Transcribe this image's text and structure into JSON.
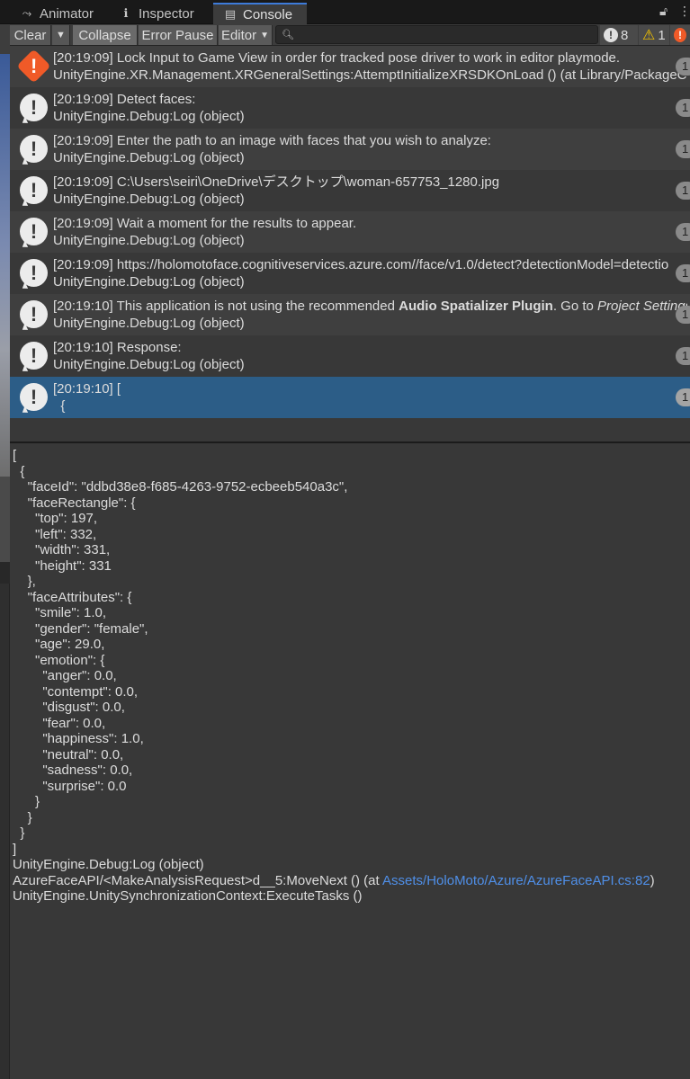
{
  "tabs": [
    {
      "label": "Animator",
      "icon": "animator-icon"
    },
    {
      "label": "Inspector",
      "icon": "info-icon"
    },
    {
      "label": "Console",
      "icon": "console-icon"
    }
  ],
  "toolbar": {
    "clear": "Clear",
    "collapse": "Collapse",
    "error_pause": "Error Pause",
    "editor": "Editor",
    "search_placeholder": "",
    "log_count": "8",
    "warn_count": "1",
    "error_count": ""
  },
  "rows": [
    {
      "type": "error",
      "line1": "[20:19:09] Lock Input to Game View in order for tracked pose driver to work in editor playmode.",
      "line2": "UnityEngine.XR.Management.XRGeneralSettings:AttemptInitializeXRSDKOnLoad () (at Library/PackageC",
      "count": "1"
    },
    {
      "type": "log",
      "line1": "[20:19:09] Detect faces:",
      "line2": "UnityEngine.Debug:Log (object)",
      "count": "1"
    },
    {
      "type": "log",
      "line1": "[20:19:09] Enter the path to an image with faces that you wish to analyze:",
      "line2": "UnityEngine.Debug:Log (object)",
      "count": "1"
    },
    {
      "type": "log",
      "line1": "[20:19:09] C:\\Users\\seiri\\OneDrive\\デスクトップ\\woman-657753_1280.jpg",
      "line2": "UnityEngine.Debug:Log (object)",
      "count": "1"
    },
    {
      "type": "log",
      "line1": "[20:19:09] Wait a moment for the results to appear.",
      "line2": "UnityEngine.Debug:Log (object)",
      "count": "1"
    },
    {
      "type": "log",
      "line1": "[20:19:09] https://holomotoface.cognitiveservices.azure.com//face/v1.0/detect?detectionModel=detectio",
      "line2": "UnityEngine.Debug:Log (object)",
      "count": "1"
    },
    {
      "type": "log",
      "line1_pre": "[20:19:10] This application is not using the recommended ",
      "line1_bold": "Audio Spatializer Plugin",
      "line1_mid": ". Go to ",
      "line1_italic": "Project Settings",
      "line2": "UnityEngine.Debug:Log (object)",
      "count": "1"
    },
    {
      "type": "log",
      "line1": "[20:19:10] Response:",
      "line2": "UnityEngine.Debug:Log (object)",
      "count": "1"
    },
    {
      "type": "log",
      "line1": "[20:19:10] [",
      "line2": "  {",
      "count": "1",
      "selected": true
    }
  ],
  "detail": {
    "lines": [
      "[",
      "  {",
      "    \"faceId\": \"ddbd38e8-f685-4263-9752-ecbeeb540a3c\",",
      "    \"faceRectangle\": {",
      "      \"top\": 197,",
      "      \"left\": 332,",
      "      \"width\": 331,",
      "      \"height\": 331",
      "    },",
      "    \"faceAttributes\": {",
      "      \"smile\": 1.0,",
      "      \"gender\": \"female\",",
      "      \"age\": 29.0,",
      "      \"emotion\": {",
      "        \"anger\": 0.0,",
      "        \"contempt\": 0.0,",
      "        \"disgust\": 0.0,",
      "        \"fear\": 0.0,",
      "        \"happiness\": 1.0,",
      "        \"neutral\": 0.0,",
      "        \"sadness\": 0.0,",
      "        \"surprise\": 0.0",
      "      }",
      "    }",
      "  }",
      "]",
      "UnityEngine.Debug:Log (object)"
    ],
    "trace_prefix": "AzureFaceAPI/<MakeAnalysisRequest>d__5:MoveNext () (at ",
    "trace_link": "Assets/HoloMoto/Azure/AzureFaceAPI.cs:82",
    "trace_suffix": ")",
    "trace_last": "UnityEngine.UnitySynchronizationContext:ExecuteTasks ()"
  }
}
